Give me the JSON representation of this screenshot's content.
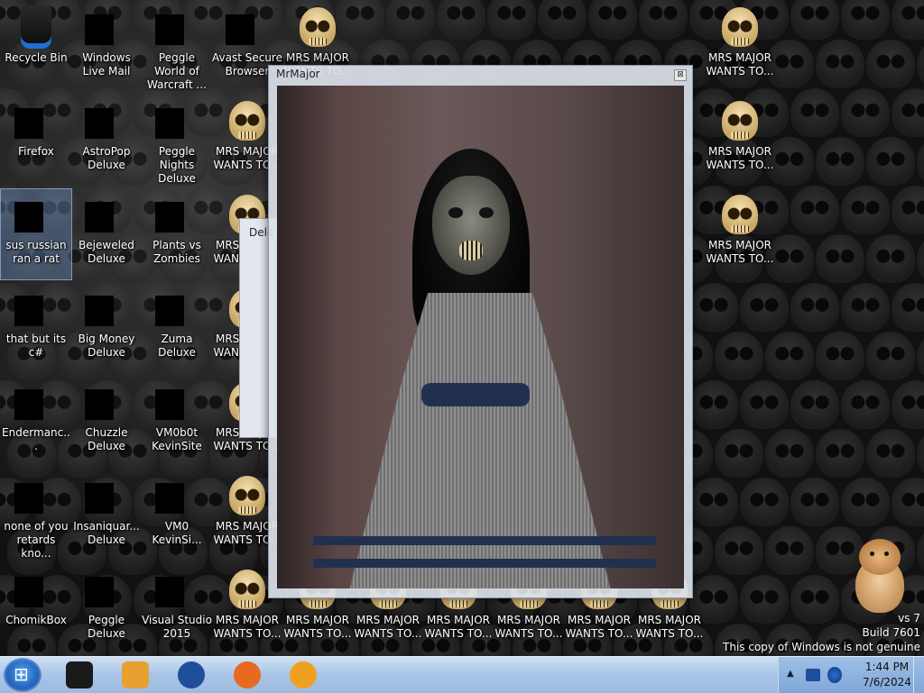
{
  "desktop": {
    "icons": [
      {
        "label": "Recycle Bin",
        "col": 0,
        "row": 0,
        "kind": "recycle"
      },
      {
        "label": "Firefox",
        "col": 0,
        "row": 1,
        "kind": "box"
      },
      {
        "label": "sus russian ran a rat",
        "col": 0,
        "row": 2,
        "kind": "box",
        "selected": true
      },
      {
        "label": "that but its c#",
        "col": 0,
        "row": 3,
        "kind": "box"
      },
      {
        "label": "Endermanc...",
        "col": 0,
        "row": 4,
        "kind": "box"
      },
      {
        "label": "none of you retards kno...",
        "col": 0,
        "row": 5,
        "kind": "box"
      },
      {
        "label": "ChomikBox",
        "col": 0,
        "row": 6,
        "kind": "box"
      },
      {
        "label": "Windows Live Mail",
        "col": 1,
        "row": 0,
        "kind": "box"
      },
      {
        "label": "AstroPop Deluxe",
        "col": 1,
        "row": 1,
        "kind": "box"
      },
      {
        "label": "Bejeweled Deluxe",
        "col": 1,
        "row": 2,
        "kind": "box"
      },
      {
        "label": "Big Money Deluxe",
        "col": 1,
        "row": 3,
        "kind": "box"
      },
      {
        "label": "Chuzzle Deluxe",
        "col": 1,
        "row": 4,
        "kind": "box"
      },
      {
        "label": "Insaniquar... Deluxe",
        "col": 1,
        "row": 5,
        "kind": "box"
      },
      {
        "label": "Peggle Deluxe",
        "col": 1,
        "row": 6,
        "kind": "box"
      },
      {
        "label": "Peggle World of Warcraft ...",
        "col": 2,
        "row": 0,
        "kind": "box"
      },
      {
        "label": "Peggle Nights Deluxe",
        "col": 2,
        "row": 1,
        "kind": "box"
      },
      {
        "label": "Plants vs Zombies",
        "col": 2,
        "row": 2,
        "kind": "box"
      },
      {
        "label": "Zuma Deluxe",
        "col": 2,
        "row": 3,
        "kind": "box"
      },
      {
        "label": "VM0b0t KevinSite",
        "col": 2,
        "row": 4,
        "kind": "box"
      },
      {
        "label": "VM0 KevinSi...",
        "col": 2,
        "row": 5,
        "kind": "box"
      },
      {
        "label": "Visual Studio 2015",
        "col": 2,
        "row": 6,
        "kind": "box"
      },
      {
        "label": "Avast Secure Browser",
        "col": 3,
        "row": 0,
        "kind": "box"
      },
      {
        "label": "MRS MAJOR WANTS TO...",
        "col": 3,
        "row": 1,
        "kind": "skull"
      },
      {
        "label": "MRS MAJOR WANTS TO...",
        "col": 3,
        "row": 2,
        "kind": "skull"
      },
      {
        "label": "MRS MAJOR WANTS TO...",
        "col": 3,
        "row": 3,
        "kind": "skull"
      },
      {
        "label": "MRS MAJOR WANTS TO...",
        "col": 3,
        "row": 4,
        "kind": "skull"
      },
      {
        "label": "MRS MAJOR WANTS TO...",
        "col": 3,
        "row": 5,
        "kind": "skull"
      },
      {
        "label": "MRS MAJOR WANTS TO...",
        "col": 3,
        "row": 6,
        "kind": "skull"
      },
      {
        "label": "MRS MAJOR WANTS TO...",
        "col": 4,
        "row": 0,
        "kind": "skull"
      },
      {
        "label": "MRS MAJOR WANTS TO...",
        "col": 4,
        "row": 6,
        "kind": "skull"
      },
      {
        "label": "MRS MAJOR WANTS TO...",
        "col": 5,
        "row": 6,
        "kind": "skull"
      },
      {
        "label": "MRS MAJOR WANTS TO...",
        "col": 6,
        "row": 6,
        "kind": "skull"
      },
      {
        "label": "MRS MAJOR WANTS TO...",
        "col": 7,
        "row": 6,
        "kind": "skull"
      },
      {
        "label": "MRS MAJOR WANTS TO...",
        "col": 8,
        "row": 6,
        "kind": "skull"
      },
      {
        "label": "MRS MAJOR WANTS TO...",
        "col": 9,
        "row": 6,
        "kind": "skull"
      },
      {
        "label": "MRS MAJOR WANTS TO...",
        "col": 10,
        "row": 0,
        "kind": "skull"
      },
      {
        "label": "MRS MAJOR WANTS TO...",
        "col": 10,
        "row": 1,
        "kind": "skull"
      },
      {
        "label": "MRS MAJOR WANTS TO...",
        "col": 10,
        "row": 2,
        "kind": "skull"
      }
    ]
  },
  "popup": {
    "title": "MrMajor",
    "close_glyph": "⊠"
  },
  "behind_dialog": {
    "title": "Dele"
  },
  "watermark": {
    "line1": "vs 7",
    "line2": "Build 7601",
    "line3": "This copy of Windows is not genuine"
  },
  "taskbar": {
    "items": [
      {
        "name": "taskbar-terminal",
        "color": "#1a1a1a"
      },
      {
        "name": "taskbar-media-player",
        "color": "#e8a030"
      },
      {
        "name": "taskbar-globe",
        "color": "#1f4f9a"
      },
      {
        "name": "taskbar-firefox",
        "color": "#e86a20"
      },
      {
        "name": "taskbar-avast-browser",
        "color": "#f0a020"
      }
    ],
    "clock": {
      "time": "1:44 PM",
      "date": "7/6/2024"
    },
    "tray_arrow": "▲"
  },
  "colors": {
    "taskbar": "#a8c4e6",
    "accent": "#1c5fb8"
  }
}
